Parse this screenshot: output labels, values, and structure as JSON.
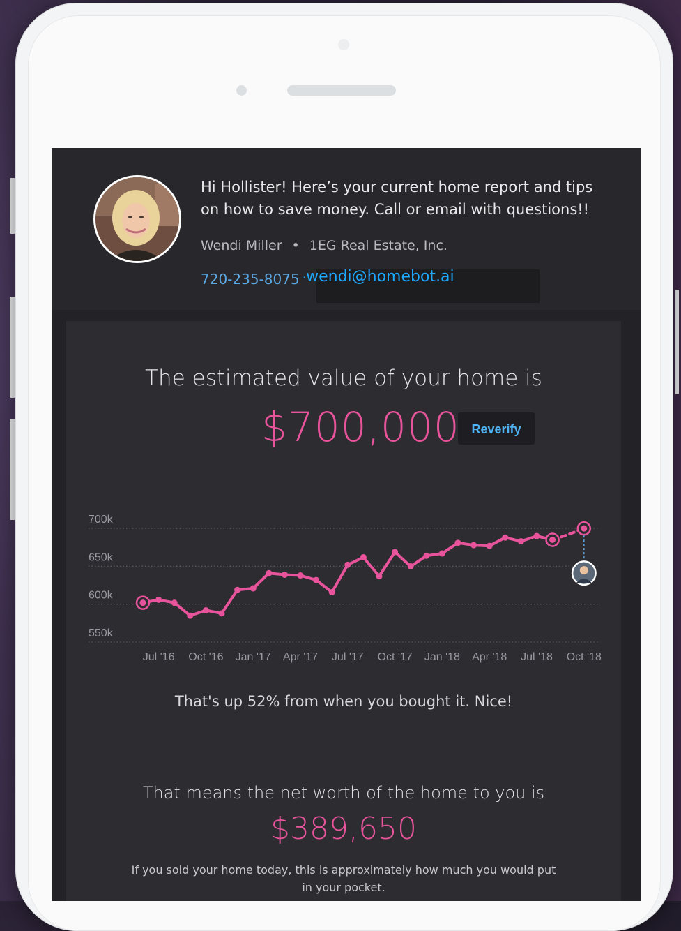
{
  "agent": {
    "message": "Hi Hollister!  Here’s your current home report and tips on how to save money.  Call or email with questions!!",
    "name": "Wendi Miller",
    "separator": "•",
    "company": "1EG Real Estate, Inc.",
    "phone": "720-235-8075",
    "email": "wendi@homebot.ai"
  },
  "report": {
    "headline": "The estimated value of your home is",
    "value": "$700,000",
    "reverify_label": "Reverify",
    "change_text": "That's up 52% from when you bought it. Nice!",
    "net_headline": "That means the net worth of the home to you is",
    "net_value": "$389,650",
    "sold_text": "If you sold your home today, this is approximately how much you would put in your pocket."
  },
  "colors": {
    "accent": "#e8549b",
    "link": "#1ea9ff",
    "button_text": "#4fb2f2"
  },
  "chart_data": {
    "type": "line",
    "y_tick_labels": [
      "700k",
      "650k",
      "600k",
      "550k"
    ],
    "y_ticks": [
      700000,
      650000,
      600000,
      550000
    ],
    "ylim": [
      545000,
      712000
    ],
    "x_tick_labels": [
      "Jul '16",
      "Oct '16",
      "Jan '17",
      "Apr '17",
      "Jul '17",
      "Oct '17",
      "Jan '18",
      "Apr '18",
      "Jul '18",
      "Oct '18"
    ],
    "x_ticks": [
      "2016-07",
      "2016-10",
      "2017-01",
      "2017-04",
      "2017-07",
      "2017-10",
      "2018-01",
      "2018-04",
      "2018-07",
      "2018-10"
    ],
    "series": [
      {
        "line_style": "solid",
        "x": [
          "2016-06",
          "2016-07",
          "2016-08",
          "2016-09",
          "2016-10",
          "2016-11",
          "2016-12",
          "2017-01",
          "2017-02",
          "2017-03",
          "2017-04",
          "2017-05",
          "2017-06",
          "2017-07",
          "2017-08",
          "2017-09",
          "2017-10",
          "2017-11",
          "2017-12",
          "2018-01",
          "2018-02",
          "2018-03",
          "2018-04",
          "2018-05",
          "2018-06",
          "2018-07",
          "2018-08"
        ],
        "values": [
          600000,
          604000,
          600000,
          583000,
          590000,
          586000,
          617000,
          619000,
          639000,
          637000,
          636000,
          630000,
          614000,
          650000,
          660000,
          635000,
          667000,
          648000,
          662000,
          665000,
          679000,
          676000,
          675000,
          686000,
          681000,
          688000,
          683000
        ]
      },
      {
        "line_style": "dashed",
        "x": [
          "2018-08",
          "2018-09",
          "2018-10"
        ],
        "values": [
          683000,
          690000,
          698000
        ]
      }
    ]
  }
}
